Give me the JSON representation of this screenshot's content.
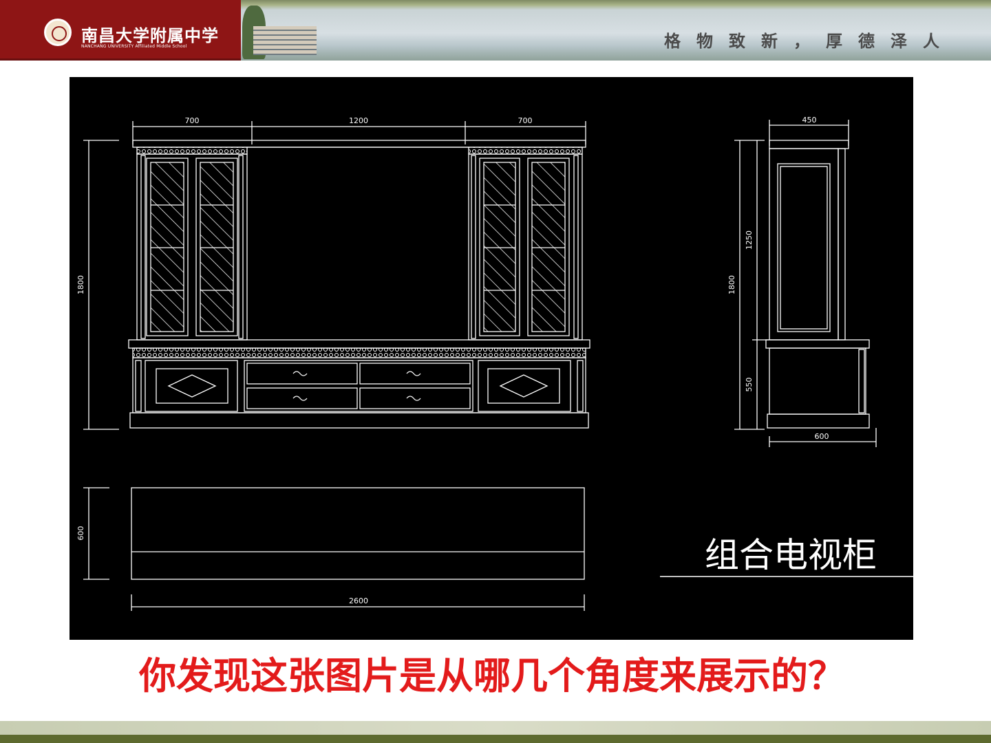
{
  "header": {
    "logo_cn": "南昌大学附属中学",
    "logo_en": "NANCHANG UNIVERSITY Affiliated Middle School",
    "motto": "格物致新，厚德泽人"
  },
  "drawing": {
    "front_dims": [
      "700",
      "1200",
      "700"
    ],
    "front_height": "1800",
    "side_top_width": "450",
    "side_height_total": "1800",
    "side_height_upper": "1250",
    "side_height_lower": "550",
    "side_bottom_width": "600",
    "plan_depth": "600",
    "plan_width": "2600",
    "title": "组合电视柜"
  },
  "question": "你发现这张图片是从哪几个角度来展示的？",
  "colors": {
    "header_red": "#8e1515",
    "question_red": "#e31b1b",
    "footer_olive": "#5d6a2f"
  }
}
